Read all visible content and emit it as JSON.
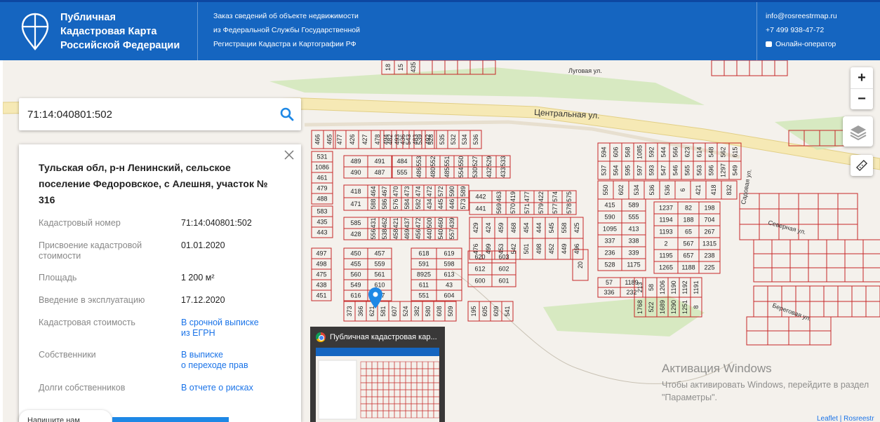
{
  "header": {
    "brand_title": "Публичная\nКадастровая Карта\nРоссийской Федерации",
    "tagline": "Заказ сведений об объекте недвижимости\nиз Федеральной Службы Государственной\nРегистрации Кадастра и Картографии РФ",
    "email": "info@rosreestrmap.ru",
    "phone": "+7 499 938-47-72",
    "chat": "Онлайн-оператор"
  },
  "search": {
    "value": "71:14:040801:502",
    "icon": "search-icon"
  },
  "card": {
    "title": "Тульская обл, р-н Ленинский, сельское поселение Федоровское, с Алешня, участок № 316",
    "rows": [
      {
        "label": "Кадастровый номер",
        "value": "71:14:040801:502",
        "link": false
      },
      {
        "label": "Присвоение кадастровой стоимости",
        "value": "01.01.2020",
        "link": false
      },
      {
        "label": "Площадь",
        "value": "1 200 м²",
        "link": false
      },
      {
        "label": "Введение в эксплуатацию",
        "value": "17.12.2020",
        "link": false
      },
      {
        "label": "Кадастровая стоимость",
        "value": "В срочной выписке\nиз ЕГРН",
        "link": true
      },
      {
        "label": "Собственники",
        "value": "В выписке\nо переходе прав",
        "link": true
      },
      {
        "label": "Долги собственников",
        "value": "В отчете о рисках",
        "link": true
      }
    ]
  },
  "bottom_tab": "Напишите нам",
  "map": {
    "streets": [
      "Центральная ул.",
      "Луговая ул.",
      "Садовая ул.",
      "Северная ул.",
      "Береговая ул."
    ],
    "lot_labels": [
      "466",
      "465",
      "477",
      "426",
      "427",
      "478",
      "482",
      "436",
      "483",
      "492",
      "494",
      "493",
      "543",
      "539",
      "528",
      "535",
      "532",
      "534",
      "536",
      "531",
      "1086",
      "461",
      "479",
      "488",
      "489",
      "491",
      "490",
      "487",
      "484",
      "555",
      "553",
      "552",
      "551",
      "550",
      "527",
      "529",
      "533",
      "486",
      "480",
      "485",
      "554",
      "530",
      "432",
      "433",
      "418",
      "471",
      "464",
      "467",
      "470",
      "473",
      "474",
      "472",
      "572",
      "590",
      "589",
      "588",
      "586",
      "576",
      "584",
      "582",
      "434",
      "445",
      "446",
      "573",
      "583",
      "435",
      "443",
      "442",
      "441",
      "463",
      "419",
      "477",
      "422",
      "574",
      "575",
      "569",
      "570",
      "571",
      "579",
      "577",
      "578",
      "585",
      "428",
      "431",
      "462",
      "421",
      "437",
      "472",
      "500",
      "460",
      "439",
      "556",
      "538",
      "458",
      "469",
      "456",
      "440",
      "540",
      "557",
      "429",
      "424",
      "459",
      "468",
      "454",
      "444",
      "545",
      "558",
      "425",
      "476",
      "499",
      "453",
      "542",
      "501",
      "498",
      "452",
      "449",
      "496",
      "497",
      "498",
      "475",
      "438",
      "451",
      "450",
      "457",
      "455",
      "559",
      "560",
      "561",
      "549",
      "610",
      "616",
      "617",
      "618",
      "619",
      "591",
      "598",
      "8925",
      "613",
      "611",
      "43",
      "551",
      "604",
      "620",
      "603",
      "612",
      "602",
      "600",
      "601",
      "373",
      "366",
      "621",
      "581",
      "607",
      "524",
      "382",
      "580",
      "608",
      "509",
      "195",
      "605",
      "609",
      "541",
      "594",
      "606",
      "568",
      "1085",
      "592",
      "544",
      "566",
      "623",
      "614",
      "548",
      "562",
      "615",
      "537",
      "564",
      "595",
      "597",
      "593",
      "547",
      "546",
      "565",
      "563",
      "596",
      "1297",
      "549",
      "550",
      "602",
      "534",
      "536",
      "536",
      "6",
      "421",
      "418",
      "832",
      "415",
      "589",
      "590",
      "555",
      "1095",
      "413",
      "337",
      "338",
      "236",
      "339",
      "528",
      "1175",
      "1237",
      "1194",
      "1193",
      "2",
      "1195",
      "1265",
      "82",
      "198",
      "188",
      "704",
      "65",
      "267",
      "567",
      "1315",
      "657",
      "238",
      "1188",
      "225",
      "57",
      "1189",
      "336",
      "232",
      "213",
      "58",
      "1206",
      "1190",
      "1192",
      "1191",
      "1768",
      "522",
      "1689",
      "1290",
      "1251",
      "8",
      "20",
      "18",
      "15",
      "435"
    ]
  },
  "controls": {
    "zoom_in": "+",
    "zoom_out": "−",
    "layers_icon": "layers-icon",
    "ruler_icon": "ruler-icon"
  },
  "preview": {
    "title": "Публичная кадастровая кар..."
  },
  "watermark": {
    "title": "Активация Windows",
    "subtitle": "Чтобы активировать Windows, перейдите в раздел \"Параметры\"."
  },
  "attribution": "Leaflet | Rosreestr",
  "colors": {
    "header": "#1565c0",
    "lot_border": "#c62828",
    "link": "#1a73e8",
    "road": "#f6e9b5",
    "green": "#cfe7b6"
  }
}
